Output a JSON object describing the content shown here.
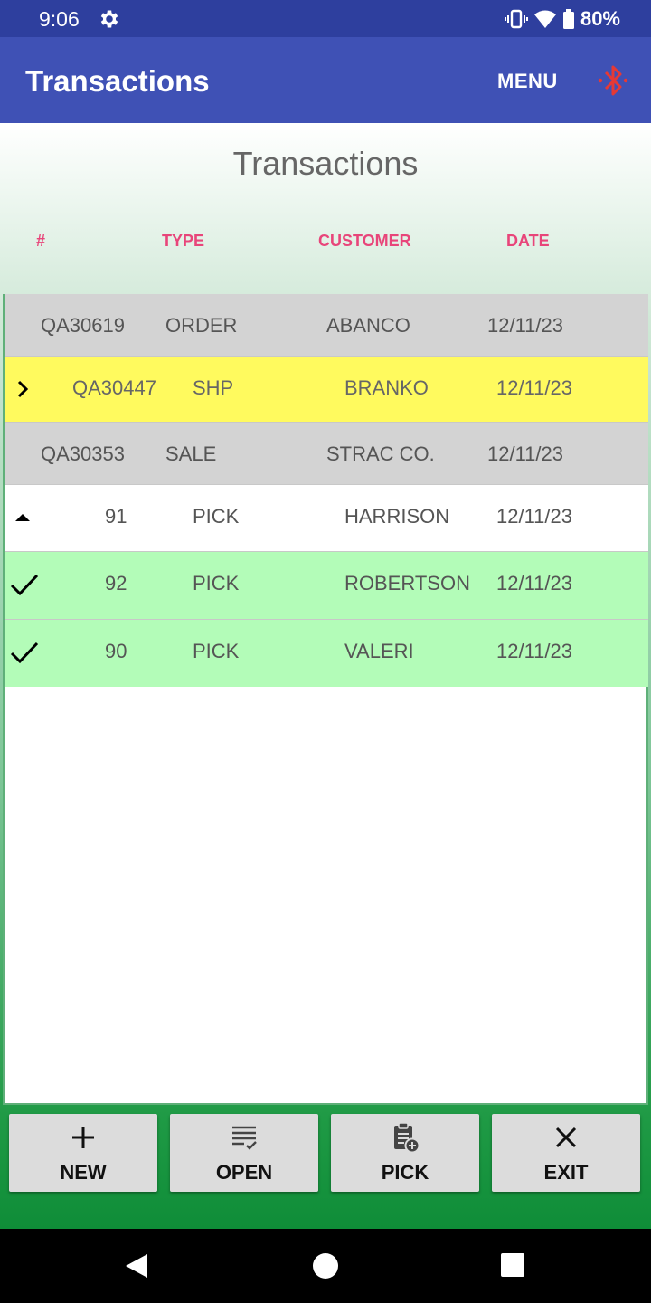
{
  "status_bar": {
    "time": "9:06",
    "battery": "80%"
  },
  "app_bar": {
    "title": "Transactions",
    "menu_label": "MENU",
    "bluetooth_color": "#e53935"
  },
  "page": {
    "heading": "Transactions"
  },
  "columns": {
    "number": "#",
    "type": "TYPE",
    "customer": "CUSTOMER",
    "date": "DATE"
  },
  "transactions": [
    {
      "number": "QA30619",
      "type": "ORDER",
      "customer": "ABANCO",
      "date": "12/11/23",
      "style": "gray",
      "marker": ""
    },
    {
      "number": "QA30447",
      "type": "SHP",
      "customer": "BRANKO",
      "date": "12/11/23",
      "style": "yellow",
      "marker": "chevron-right"
    },
    {
      "number": "QA30353",
      "type": "SALE",
      "customer": "STRAC CO.",
      "date": "12/11/23",
      "style": "gray",
      "marker": ""
    },
    {
      "number": "91",
      "type": "PICK",
      "customer": "HARRISON",
      "date": "12/11/23",
      "style": "white",
      "marker": "triangle-up"
    },
    {
      "number": "92",
      "type": "PICK",
      "customer": "ROBERTSON",
      "date": "12/11/23",
      "style": "green",
      "marker": "checkmark"
    },
    {
      "number": "90",
      "type": "PICK",
      "customer": "VALERI",
      "date": "12/11/23",
      "style": "green",
      "marker": "checkmark"
    }
  ],
  "buttons": {
    "new": "NEW",
    "open": "OPEN",
    "pick": "PICK",
    "exit": "EXIT"
  },
  "colors": {
    "app_bar": "#3f51b5",
    "status_bar": "#2e3f9e",
    "header_text": "#e8457a",
    "selected_row": "#fffa5e",
    "done_row": "#b3fcb8"
  }
}
